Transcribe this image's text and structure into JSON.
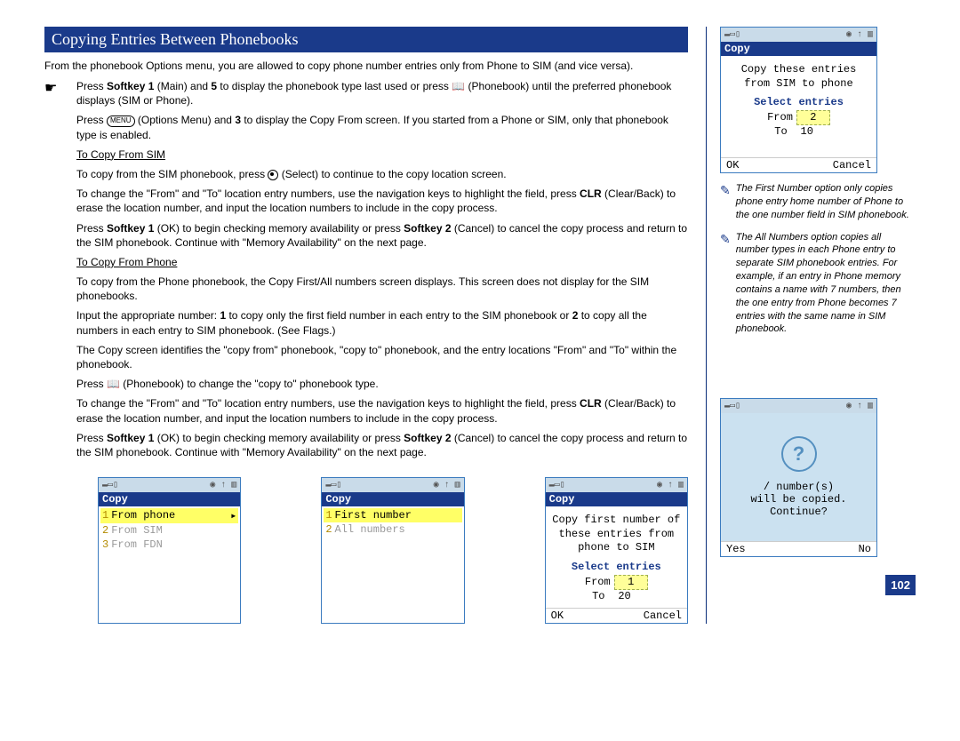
{
  "section_title": "Copying Entries Between Phonebooks",
  "intro": "From the phonebook Options menu, you are allowed to copy phone number entries only from Phone to SIM (and vice versa).",
  "step1_a": "Press ",
  "step1_b": "Softkey 1",
  "step1_c": " (Main) and ",
  "step1_d": "5",
  "step1_e": " to display the phonebook type last used or press ",
  "step1_f": " (Phonebook) until the preferred phonebook displays (SIM or Phone).",
  "step2_a": "Press ",
  "step2_menu": "MENU",
  "step2_b": " (Options Menu) and ",
  "step2_c": "3",
  "step2_d": " to display the Copy From screen. If you started from a Phone or SIM, only that phonebook type is enabled.",
  "h_sim": "To Copy From SIM",
  "sim1_a": "To copy from the SIM phonebook, press ",
  "sim1_b": " (Select) to continue to the copy location screen.",
  "sim2_a": "To change the \"From\" and \"To\" location entry numbers, use the navigation keys to highlight the field, press ",
  "sim2_b": "CLR",
  "sim2_c": " (Clear/Back) to erase the location number, and input the location numbers to include in the copy process.",
  "sim3_a": "Press ",
  "sim3_b": "Softkey 1",
  "sim3_c": " (OK) to begin checking memory availability or press ",
  "sim3_d": "Softkey 2",
  "sim3_e": " (Cancel) to cancel the copy process and return to the SIM phonebook. Continue with \"Memory Availability\" on the next page.",
  "h_phone": "To Copy From Phone",
  "ph1": "To copy from the Phone phonebook, the Copy First/All numbers screen displays. This screen does not display for the SIM phonebooks.",
  "ph2_a": "Input the appropriate number: ",
  "ph2_b": "1",
  "ph2_c": " to copy only the first field number in each entry to the SIM phonebook or ",
  "ph2_d": "2",
  "ph2_e": " to copy all the numbers in each entry to SIM phonebook. (See Flags.)",
  "ph3": "The Copy screen identifies the \"copy from\" phonebook, \"copy to\" phonebook, and the entry locations \"From\" and \"To\" within the phonebook.",
  "ph4_a": "Press ",
  "ph4_b": " (Phonebook) to change the \"copy to\" phonebook type.",
  "ph5_a": "To change the \"From\" and \"To\" location entry numbers, use the navigation keys to highlight the field, press ",
  "ph5_b": "CLR",
  "ph5_c": " (Clear/Back) to erase the location number, and input the location numbers to include in the copy process.",
  "ph6_a": "Press ",
  "ph6_b": "Softkey 1",
  "ph6_c": " (OK) to begin checking memory availability or press ",
  "ph6_d": "Softkey 2",
  "ph6_e": " (Cancel) to cancel the copy process and return to the SIM phonebook. Continue with \"Memory Availability\" on the next page.",
  "screens": {
    "s1": {
      "title": "Copy",
      "items": [
        {
          "num": "1",
          "label": "From phone",
          "sel": true
        },
        {
          "num": "2",
          "label": "From SIM",
          "sel": false
        },
        {
          "num": "3",
          "label": "From FDN",
          "sel": false
        }
      ]
    },
    "s2": {
      "title": "Copy",
      "items": [
        {
          "num": "1",
          "label": "First number",
          "sel": true
        },
        {
          "num": "2",
          "label": "All numbers",
          "sel": false
        }
      ]
    },
    "s3": {
      "title": "Copy",
      "body1": "Copy first number of",
      "body2": "these entries from",
      "body3": "phone to SIM",
      "sel": "Select entries",
      "from_lbl": "From",
      "from_val": "1",
      "to_lbl": "To",
      "to_val": "20",
      "ok": "OK",
      "cancel": "Cancel"
    },
    "side_top": {
      "title": "Copy",
      "body1": "Copy these entries",
      "body2": "from SIM to phone",
      "sel": "Select entries",
      "from_lbl": "From",
      "from_val": "2",
      "to_lbl": "To",
      "to_val": "10",
      "ok": "OK",
      "cancel": "Cancel"
    },
    "side_bot": {
      "msg1": "/ number(s)",
      "msg2": "will be copied.",
      "msg3": "Continue?",
      "yes": "Yes",
      "no": "No"
    }
  },
  "note1": "The First Number option only copies phone entry home number of Phone to the one number field in SIM phonebook.",
  "note2": "The All Numbers option copies all number types in each Phone entry to separate SIM phonebook entries. For example, if an entry in Phone memory contains a name with 7 numbers, then the one entry from Phone becomes 7 entries with the same name in SIM phonebook.",
  "topbar_left": "▬▭▯",
  "topbar_right": "◉ ↑ ▥",
  "page_num": "102"
}
